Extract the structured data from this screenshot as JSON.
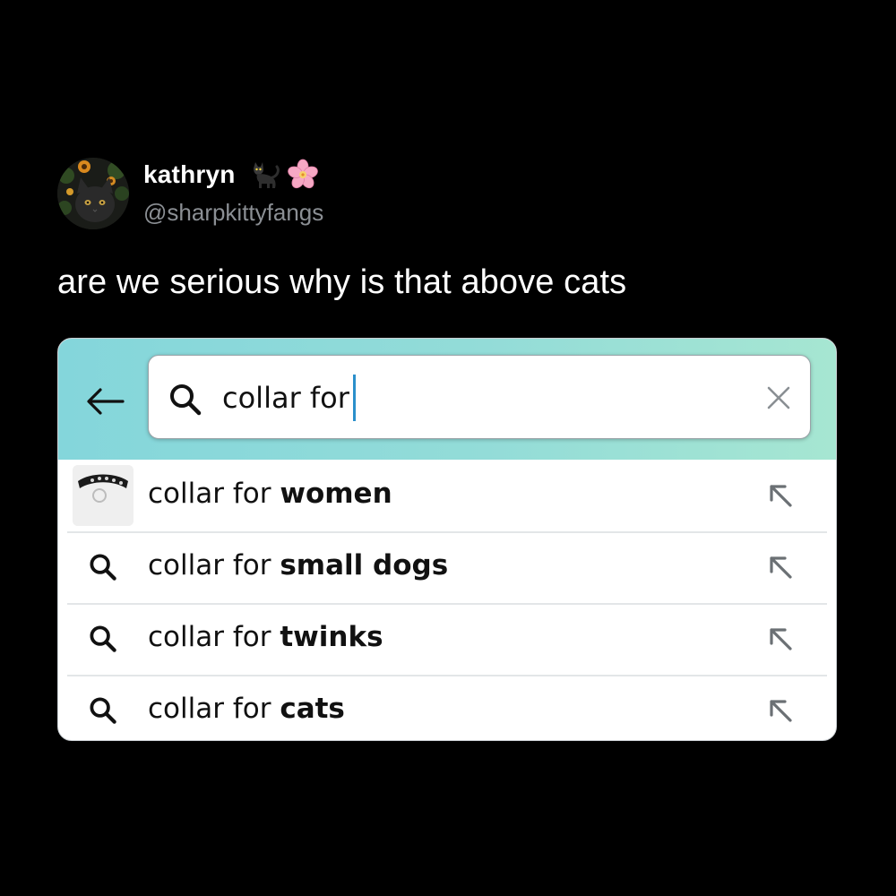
{
  "tweet": {
    "display_name": "kathryn",
    "name_emojis": [
      "black-cat-emoji",
      "cherry-blossom-emoji"
    ],
    "handle": "@sharpkittyfangs",
    "text": "are we serious why is that above cats"
  },
  "screenshot": {
    "header_gradient": [
      "#84d6db",
      "#a6e6d2"
    ],
    "search": {
      "value": "collar for",
      "caret_color": "#2b8fcb"
    },
    "suggestions": [
      {
        "prefix": "collar for ",
        "bold": "women",
        "icon": "collar-thumbnail"
      },
      {
        "prefix": "collar for ",
        "bold": "small dogs",
        "icon": "search-icon"
      },
      {
        "prefix": "collar for ",
        "bold": "twinks",
        "icon": "search-icon"
      },
      {
        "prefix": "collar for ",
        "bold": "cats",
        "icon": "search-icon"
      }
    ]
  }
}
